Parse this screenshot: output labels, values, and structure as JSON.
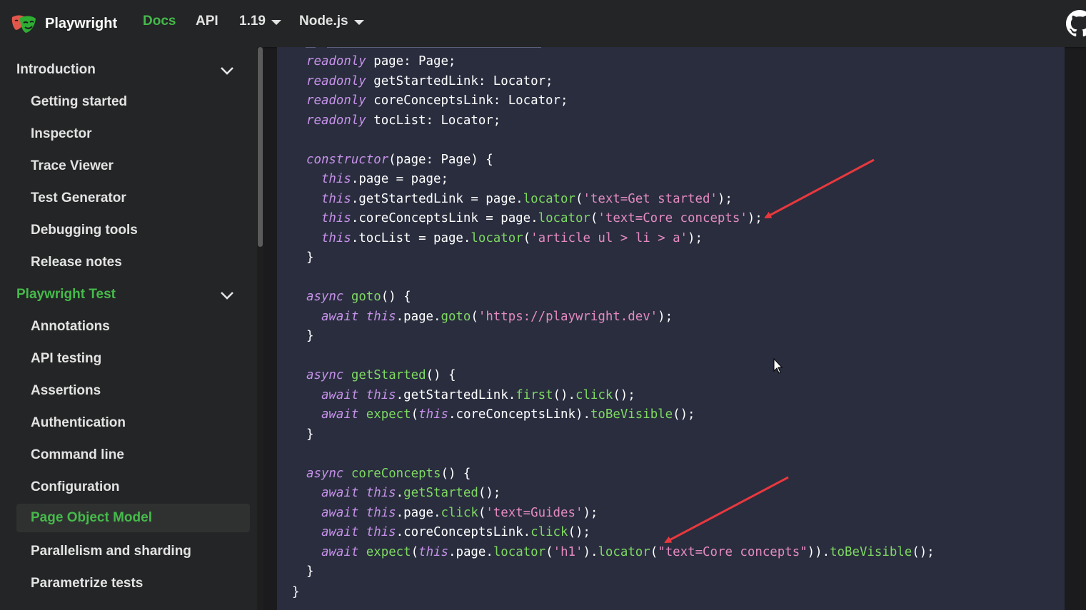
{
  "navbar": {
    "brand": "Playwright",
    "links": [
      "Docs",
      "API"
    ],
    "version": "1.19",
    "language": "Node.js",
    "icons": {
      "logo": "playwright-masks-logo",
      "github": "github-icon"
    }
  },
  "sidebar": {
    "categories": [
      {
        "label": "Introduction",
        "items": [
          "Getting started",
          "Inspector",
          "Trace Viewer",
          "Test Generator",
          "Debugging tools",
          "Release notes"
        ]
      },
      {
        "label": "Playwright Test",
        "items": [
          "Annotations",
          "API testing",
          "Assertions",
          "Authentication",
          "Command line",
          "Configuration",
          "Page Object Model",
          "Parallelism and sharding",
          "Parametrize tests"
        ]
      }
    ],
    "active_item": "Page Object Model"
  },
  "code": {
    "lines": [
      [
        [
          "kw",
          "readonly"
        ],
        [
          "pl",
          " page: Page;"
        ]
      ],
      [
        [
          "kw",
          "readonly"
        ],
        [
          "pl",
          " getStartedLink: Locator;"
        ]
      ],
      [
        [
          "kw",
          "readonly"
        ],
        [
          "pl",
          " coreConceptsLink: Locator;"
        ]
      ],
      [
        [
          "kw",
          "readonly"
        ],
        [
          "pl",
          " tocList: Locator;"
        ]
      ],
      [],
      [
        [
          "kw",
          "constructor"
        ],
        [
          "pl",
          "(page: Page) {"
        ]
      ],
      [
        [
          "pl",
          "  "
        ],
        [
          "kw",
          "this"
        ],
        [
          "pl",
          ".page = page;"
        ]
      ],
      [
        [
          "pl",
          "  "
        ],
        [
          "kw",
          "this"
        ],
        [
          "pl",
          ".getStartedLink = page."
        ],
        [
          "fn",
          "locator"
        ],
        [
          "pl",
          "("
        ],
        [
          "str",
          "'text=Get started'"
        ],
        [
          "pl",
          ");"
        ]
      ],
      [
        [
          "pl",
          "  "
        ],
        [
          "kw",
          "this"
        ],
        [
          "pl",
          ".coreConceptsLink = page."
        ],
        [
          "fn",
          "locator"
        ],
        [
          "pl",
          "("
        ],
        [
          "str",
          "'text=Core concepts'"
        ],
        [
          "pl",
          ");"
        ]
      ],
      [
        [
          "pl",
          "  "
        ],
        [
          "kw",
          "this"
        ],
        [
          "pl",
          ".tocList = page."
        ],
        [
          "fn",
          "locator"
        ],
        [
          "pl",
          "("
        ],
        [
          "str",
          "'article ul > li > a'"
        ],
        [
          "pl",
          ");"
        ]
      ],
      [
        [
          "pl",
          "}"
        ]
      ],
      [],
      [
        [
          "kw",
          "async"
        ],
        [
          "pl",
          " "
        ],
        [
          "fn",
          "goto"
        ],
        [
          "pl",
          "() {"
        ]
      ],
      [
        [
          "pl",
          "  "
        ],
        [
          "kw",
          "await this"
        ],
        [
          "pl",
          ".page."
        ],
        [
          "fn",
          "goto"
        ],
        [
          "pl",
          "("
        ],
        [
          "str",
          "'https://playwright.dev'"
        ],
        [
          "pl",
          ");"
        ]
      ],
      [
        [
          "pl",
          "}"
        ]
      ],
      [],
      [
        [
          "kw",
          "async"
        ],
        [
          "pl",
          " "
        ],
        [
          "fn",
          "getStarted"
        ],
        [
          "pl",
          "() {"
        ]
      ],
      [
        [
          "pl",
          "  "
        ],
        [
          "kw",
          "await this"
        ],
        [
          "pl",
          ".getStartedLink."
        ],
        [
          "fn",
          "first"
        ],
        [
          "pl",
          "()."
        ],
        [
          "fn",
          "click"
        ],
        [
          "pl",
          "();"
        ]
      ],
      [
        [
          "pl",
          "  "
        ],
        [
          "kw",
          "await"
        ],
        [
          "pl",
          " "
        ],
        [
          "fn",
          "expect"
        ],
        [
          "pl",
          "("
        ],
        [
          "kw",
          "this"
        ],
        [
          "pl",
          ".coreConceptsLink)."
        ],
        [
          "fn",
          "toBeVisible"
        ],
        [
          "pl",
          "();"
        ]
      ],
      [
        [
          "pl",
          "}"
        ]
      ],
      [],
      [
        [
          "kw",
          "async"
        ],
        [
          "pl",
          " "
        ],
        [
          "fn",
          "coreConcepts"
        ],
        [
          "pl",
          "() {"
        ]
      ],
      [
        [
          "pl",
          "  "
        ],
        [
          "kw",
          "await this"
        ],
        [
          "pl",
          "."
        ],
        [
          "fn",
          "getStarted"
        ],
        [
          "pl",
          "();"
        ]
      ],
      [
        [
          "pl",
          "  "
        ],
        [
          "kw",
          "await this"
        ],
        [
          "pl",
          ".page."
        ],
        [
          "fn",
          "click"
        ],
        [
          "pl",
          "("
        ],
        [
          "str",
          "'text=Guides'"
        ],
        [
          "pl",
          ");"
        ]
      ],
      [
        [
          "pl",
          "  "
        ],
        [
          "kw",
          "await this"
        ],
        [
          "pl",
          ".coreConceptsLink."
        ],
        [
          "fn",
          "click"
        ],
        [
          "pl",
          "();"
        ]
      ],
      [
        [
          "pl",
          "  "
        ],
        [
          "kw",
          "await"
        ],
        [
          "pl",
          " "
        ],
        [
          "fn",
          "expect"
        ],
        [
          "pl",
          "("
        ],
        [
          "kw",
          "this"
        ],
        [
          "pl",
          ".page."
        ],
        [
          "fn",
          "locator"
        ],
        [
          "pl",
          "("
        ],
        [
          "str",
          "'h1'"
        ],
        [
          "pl",
          ")."
        ],
        [
          "fn",
          "locator"
        ],
        [
          "pl",
          "("
        ],
        [
          "str",
          "\"text=Core concepts\""
        ],
        [
          "pl",
          "))."
        ],
        [
          "fn",
          "toBeVisible"
        ],
        [
          "pl",
          "();"
        ]
      ],
      [
        [
          "pl",
          "}"
        ]
      ]
    ],
    "closing_brace": "}"
  },
  "colors": {
    "accent": "#45ba4b",
    "navbar_bg": "#242526",
    "code_bg": "#292d3e",
    "annotation_arrow": "#e8383d"
  }
}
